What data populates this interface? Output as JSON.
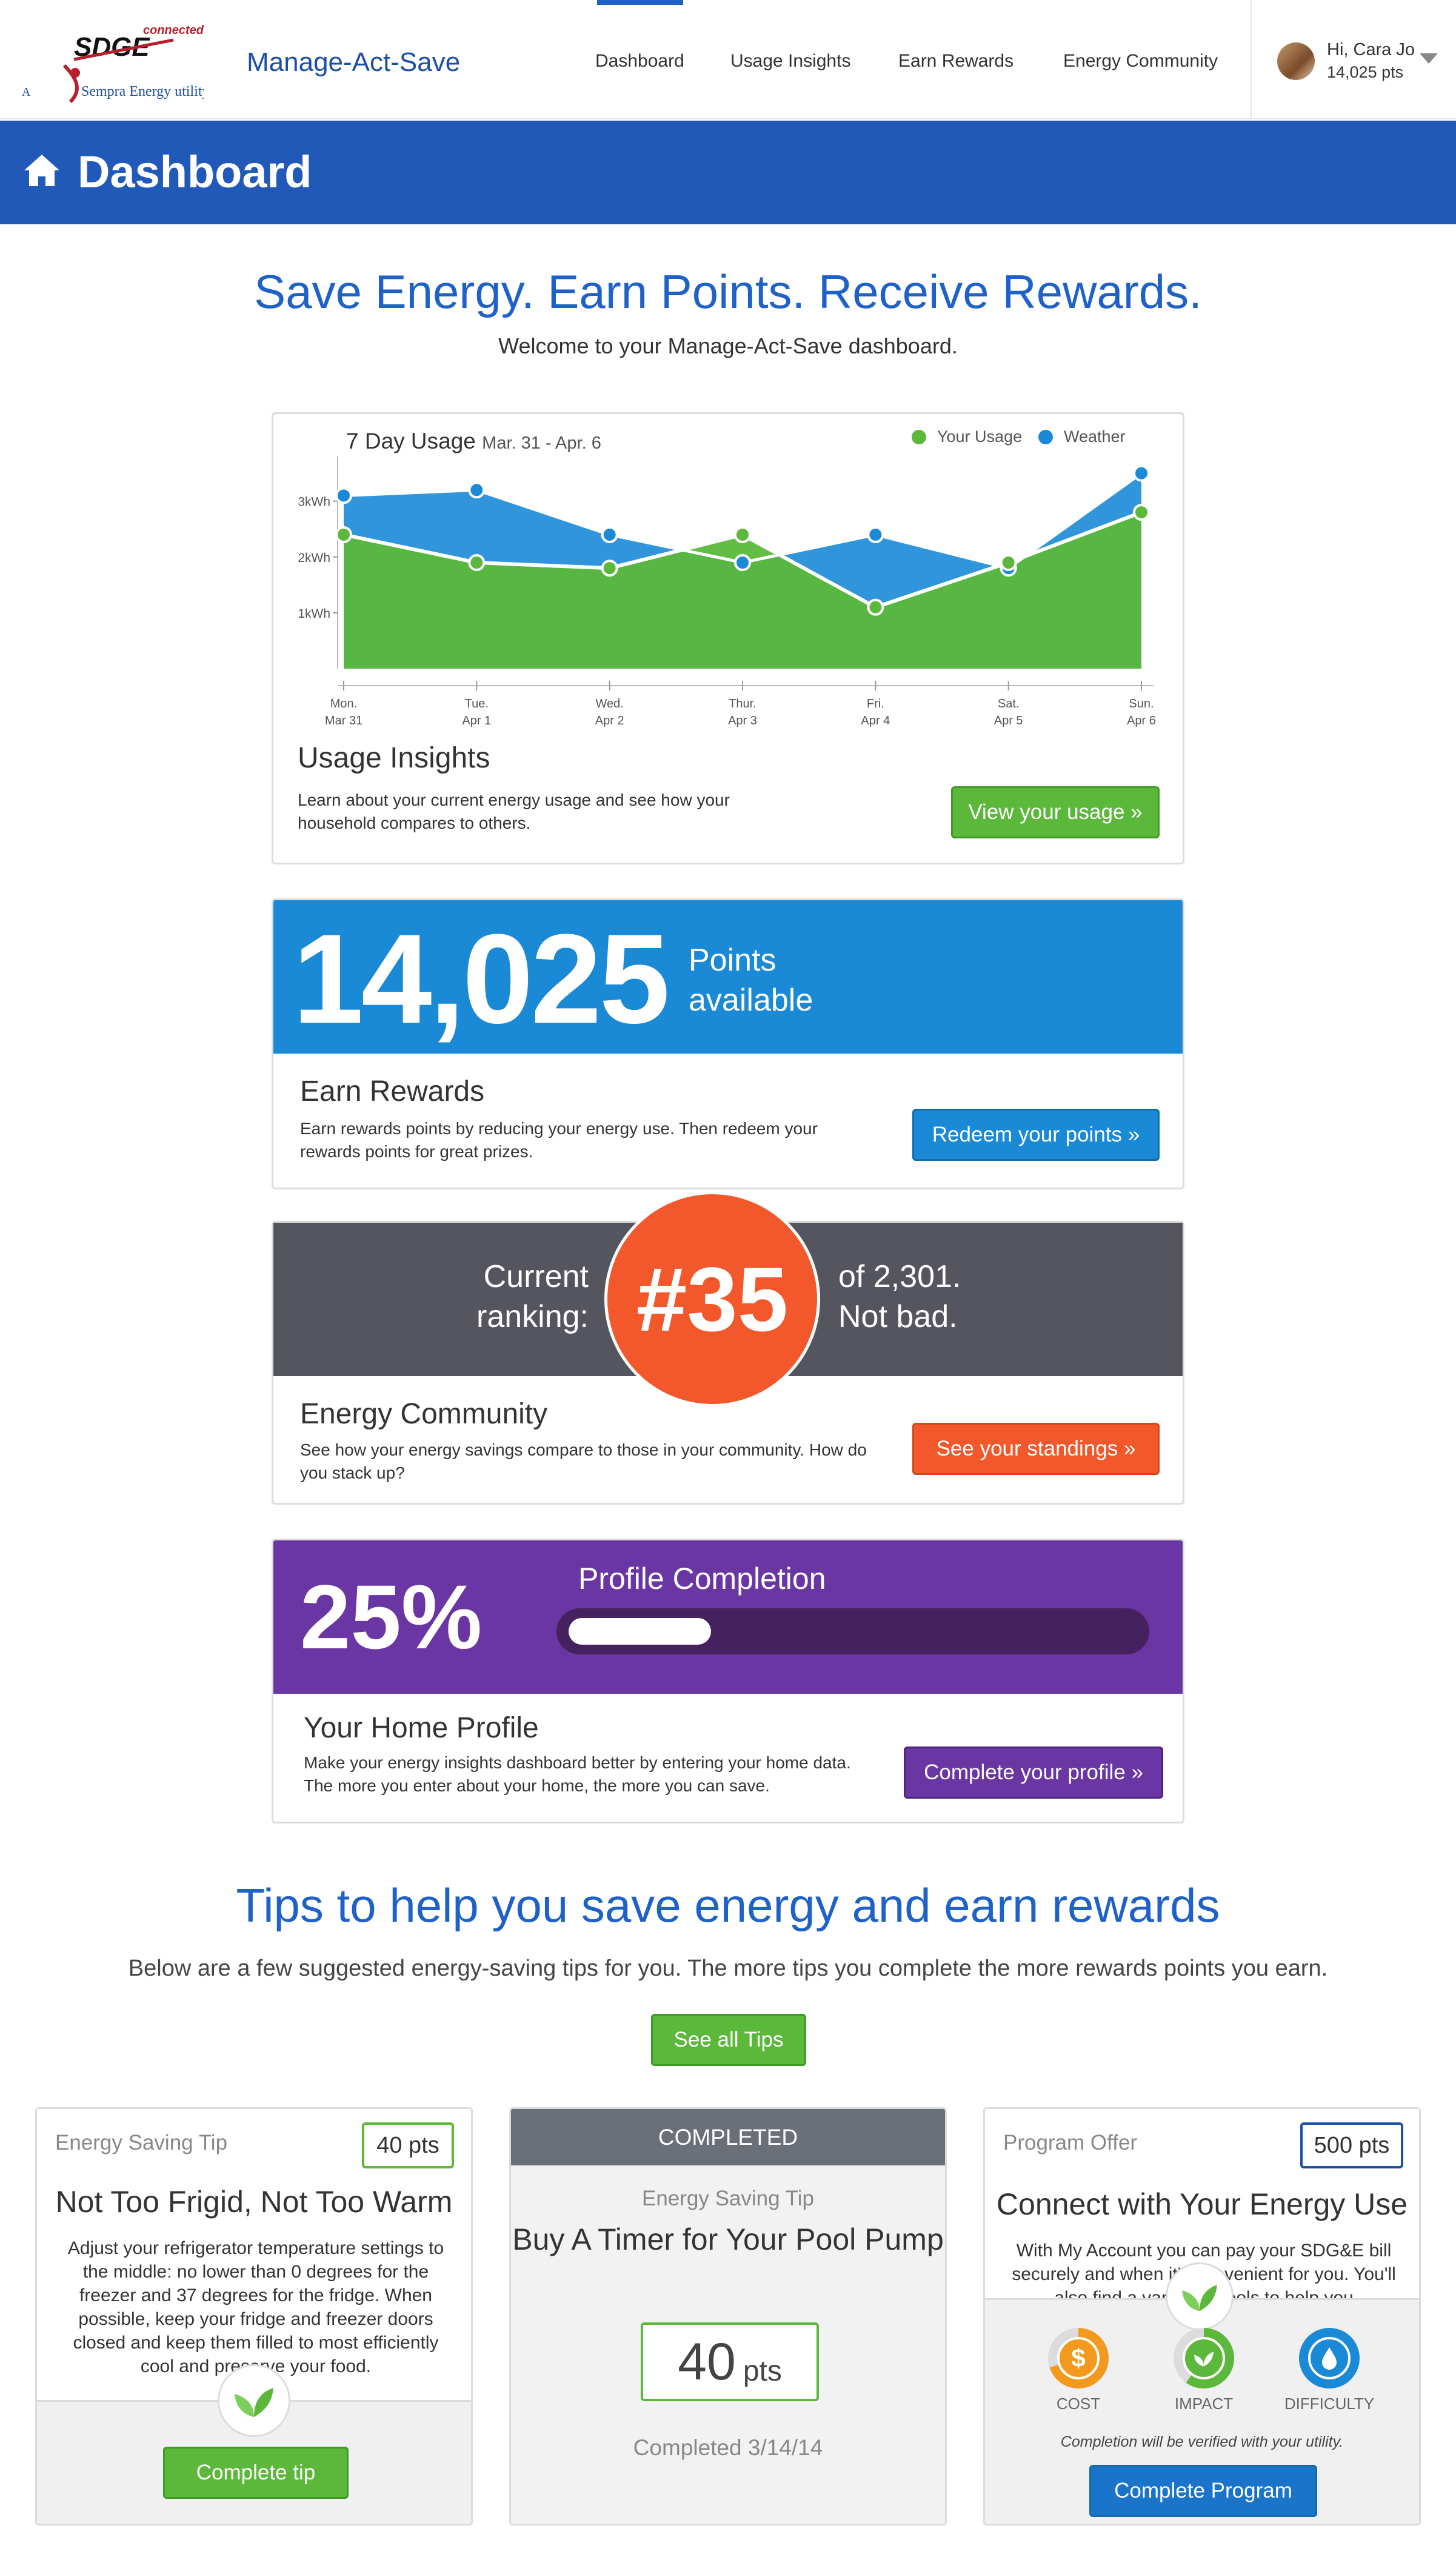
{
  "header": {
    "brand_name": "Manage-Act-Save",
    "logo": {
      "text": "SDGE",
      "tag": "connected",
      "sub": "Sempra Energy utility"
    },
    "nav": [
      {
        "label": "Dashboard",
        "active": true
      },
      {
        "label": "Usage Insights",
        "active": false
      },
      {
        "label": "Earn Rewards",
        "active": false
      },
      {
        "label": "Energy Community",
        "active": false
      }
    ],
    "user": {
      "greeting": "Hi, Cara Jo",
      "points": "14,025 pts"
    }
  },
  "page_title": "Dashboard",
  "hero": {
    "title": "Save Energy. Earn Points. Receive Rewards.",
    "subtitle": "Welcome to your Manage-Act-Save dashboard."
  },
  "usage_card": {
    "chart_title": "7 Day Usage",
    "chart_range": "Mar. 31 - Apr. 6",
    "heading": "Usage Insights",
    "text": "Learn about your current energy usage and see how your household compares to others.",
    "button": "View your usage »"
  },
  "chart_data": {
    "type": "area",
    "title": "7 Day Usage",
    "subtitle": "Mar. 31 - Apr. 6",
    "x": [
      "Mon. Mar 31",
      "Tue. Apr 1",
      "Wed. Apr 2",
      "Thur. Apr 3",
      "Fri. Apr 4",
      "Sat. Apr 5",
      "Sun. Apr 6"
    ],
    "x_day": [
      "Mon.",
      "Tue.",
      "Wed.",
      "Thur.",
      "Fri.",
      "Sat.",
      "Sun."
    ],
    "x_date": [
      "Mar 31",
      "Apr 1",
      "Apr 2",
      "Apr 3",
      "Apr 4",
      "Apr 5",
      "Apr 6"
    ],
    "yticks": [
      "1kWh",
      "2kWh",
      "3kWh"
    ],
    "ylim": [
      0,
      3.8
    ],
    "legend_position": "top-right",
    "series": [
      {
        "name": "Your Usage",
        "color": "#5bb83a",
        "values": [
          2.4,
          1.9,
          1.8,
          2.4,
          1.1,
          1.9,
          2.8
        ]
      },
      {
        "name": "Weather",
        "color": "#1a89d6",
        "values": [
          3.1,
          3.2,
          2.4,
          1.9,
          2.4,
          1.8,
          3.5
        ]
      }
    ]
  },
  "points_card": {
    "value": "14,025",
    "label_line1": "Points",
    "label_line2": "available",
    "heading": "Earn Rewards",
    "text": "Earn rewards points by reducing your energy use. Then redeem your rewards points for great prizes.",
    "button": "Redeem your points »"
  },
  "ranking_card": {
    "left_line1": "Current",
    "left_line2": "ranking:",
    "rank": "#35",
    "right_line1": "of 2,301.",
    "right_line2": "Not bad.",
    "heading": "Energy Community",
    "text": "See how your energy savings compare to those in your community. How do you stack up?",
    "button": "See your standings »"
  },
  "profile_card": {
    "percent_text": "25%",
    "percent_value": 0.25,
    "bar_title": "Profile Completion",
    "heading": "Your Home Profile",
    "text": "Make your energy insights dashboard better by entering your home data. The more you enter about your home, the more you can save.",
    "button": "Complete your profile »"
  },
  "tips": {
    "title": "Tips to help you save energy and earn rewards",
    "subtitle": "Below are a few suggested energy-saving tips for you. The more tips you complete the more rewards points you earn.",
    "see_all": "See all Tips",
    "cards": [
      {
        "kind": "Energy Saving Tip",
        "points": "40 pts",
        "title": "Not Too Frigid, Not Too Warm",
        "body": "Adjust your refrigerator temperature settings to the middle: no lower than 0 degrees for the freezer and 37 degrees for the fridge. When possible, keep your fridge and freezer doors closed and keep them filled to most efficiently cool and preserve your food.",
        "button": "Complete tip"
      },
      {
        "status": "COMPLETED",
        "kind": "Energy Saving Tip",
        "title": "Buy A Timer for Your Pool Pump",
        "points_num": "40",
        "points_unit": "pts",
        "completed": "Completed 3/14/14"
      },
      {
        "kind": "Program Offer",
        "points": "500 pts",
        "title": "Connect with Your Energy Use",
        "body": "With My Account you can pay your SDG&E bill securely and when it's convenient for you. You'll also find a variety of tools to help you",
        "metrics": [
          "COST",
          "IMPACT",
          "DIFFICULTY"
        ],
        "note": "Completion will be verified with your utility.",
        "button": "Complete Program"
      }
    ]
  }
}
